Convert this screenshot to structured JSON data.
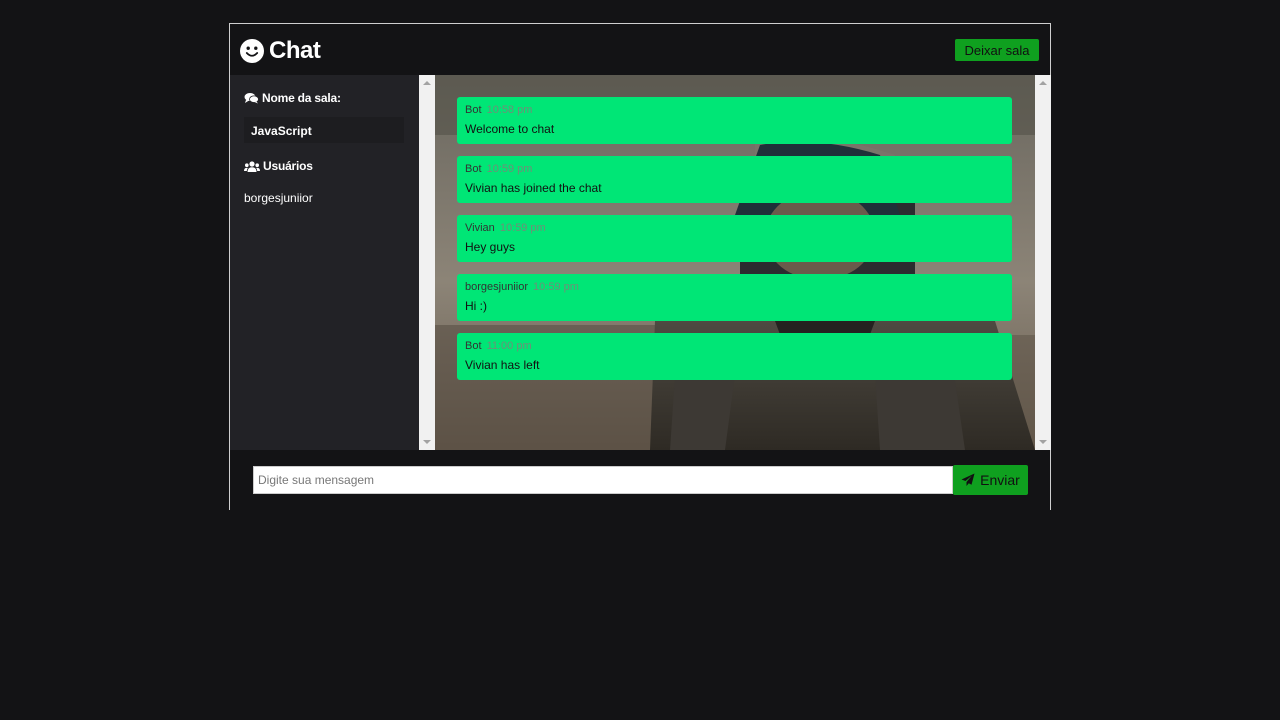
{
  "header": {
    "title": "Chat",
    "leave_label": "Deixar sala"
  },
  "sidebar": {
    "room_heading": "Nome da sala:",
    "room_name": "JavaScript",
    "users_heading": "Usuários",
    "users": [
      "borgesjuniior"
    ]
  },
  "messages": [
    {
      "author": "Bot",
      "time": "10:58 pm",
      "text": "Welcome to chat"
    },
    {
      "author": "Bot",
      "time": "10:59 pm",
      "text": "Vivian has joined the chat"
    },
    {
      "author": "Vivian",
      "time": "10:59 pm",
      "text": "Hey guys"
    },
    {
      "author": "borgesjuniior",
      "time": "10:59 pm",
      "text": "Hi :)"
    },
    {
      "author": "Bot",
      "time": "11:00 pm",
      "text": "Vivian has left"
    }
  ],
  "composer": {
    "placeholder": "Digite sua mensagem",
    "value": "",
    "send_label": "Enviar"
  },
  "colors": {
    "background": "#131315",
    "sidebar": "#222226",
    "accent": "#0fa01f",
    "message_bubble": "#00e676"
  },
  "icons": {
    "logo": "smile-icon",
    "room": "comments-icon",
    "users": "users-icon",
    "send": "paper-plane-icon"
  }
}
